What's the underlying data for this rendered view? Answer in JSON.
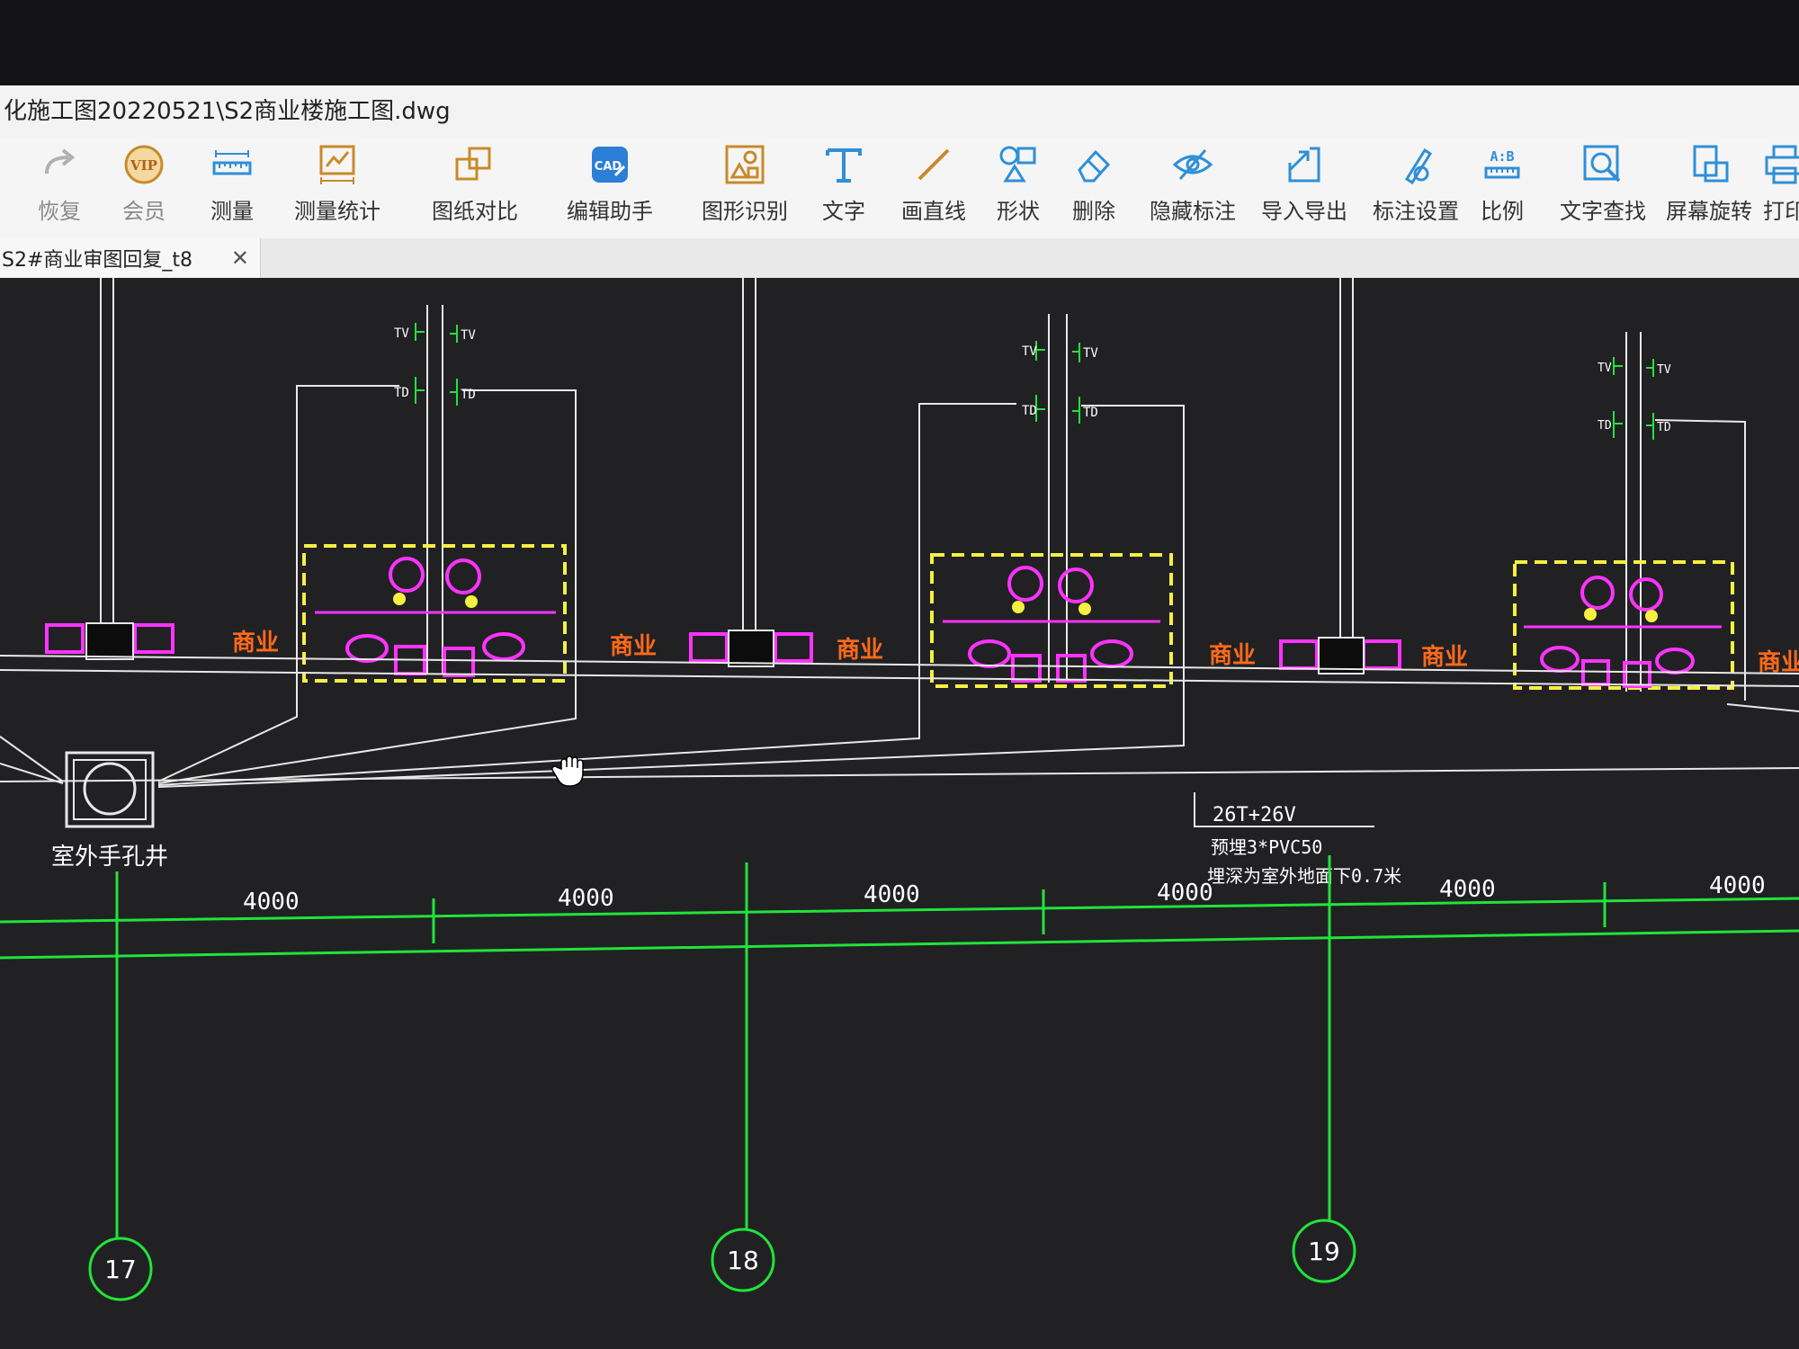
{
  "window": {
    "title": "化施工图20220521\\S2商业楼施工图.dwg"
  },
  "toolbar": {
    "items": [
      {
        "label": "恢复",
        "icon": "redo-icon"
      },
      {
        "label": "会员",
        "icon": "vip-icon"
      },
      {
        "label": "测量",
        "icon": "measure-ruler-icon"
      },
      {
        "label": "测量统计",
        "icon": "measure-stats-icon"
      },
      {
        "label": "图纸对比",
        "icon": "compare-icon"
      },
      {
        "label": "编辑助手",
        "icon": "cad-edit-icon"
      },
      {
        "label": "图形识别",
        "icon": "shape-recognize-icon"
      },
      {
        "label": "文字",
        "icon": "text-icon"
      },
      {
        "label": "画直线",
        "icon": "draw-line-icon"
      },
      {
        "label": "形状",
        "icon": "shapes-icon"
      },
      {
        "label": "删除",
        "icon": "eraser-icon"
      },
      {
        "label": "隐藏标注",
        "icon": "hide-annotation-icon"
      },
      {
        "label": "导入导出",
        "icon": "import-export-icon"
      },
      {
        "label": "标注设置",
        "icon": "annotation-settings-icon"
      },
      {
        "label": "比例",
        "icon": "scale-icon"
      },
      {
        "label": "文字查找",
        "icon": "text-search-icon"
      },
      {
        "label": "屏幕旋转",
        "icon": "screen-rotate-icon"
      },
      {
        "label": "打印",
        "icon": "print-icon"
      }
    ]
  },
  "tab": {
    "label": "S2#商业审图回复_t8",
    "close": "✕"
  },
  "drawing": {
    "pipe_labels": {
      "tv": "TV",
      "td": "TD"
    },
    "zone_label": "商业",
    "manhole_label": "室外手孔井",
    "cable_note": {
      "line1": "26T+26V",
      "line2": "预埋3*PVC50",
      "line3": "埋深为室外地面下0.7米"
    },
    "dimensions": [
      "4000",
      "4000",
      "4000",
      "4000",
      "4000",
      "4000"
    ],
    "axis_markers": [
      "17",
      "18",
      "19"
    ]
  },
  "colors": {
    "canvas_bg": "#212124",
    "wall": "#e8e8e8",
    "grid_green": "#22e33a",
    "fixture_magenta": "#ff33ff",
    "hatch_yellow": "#f5f042",
    "zone_orange": "#ff6a1a"
  }
}
